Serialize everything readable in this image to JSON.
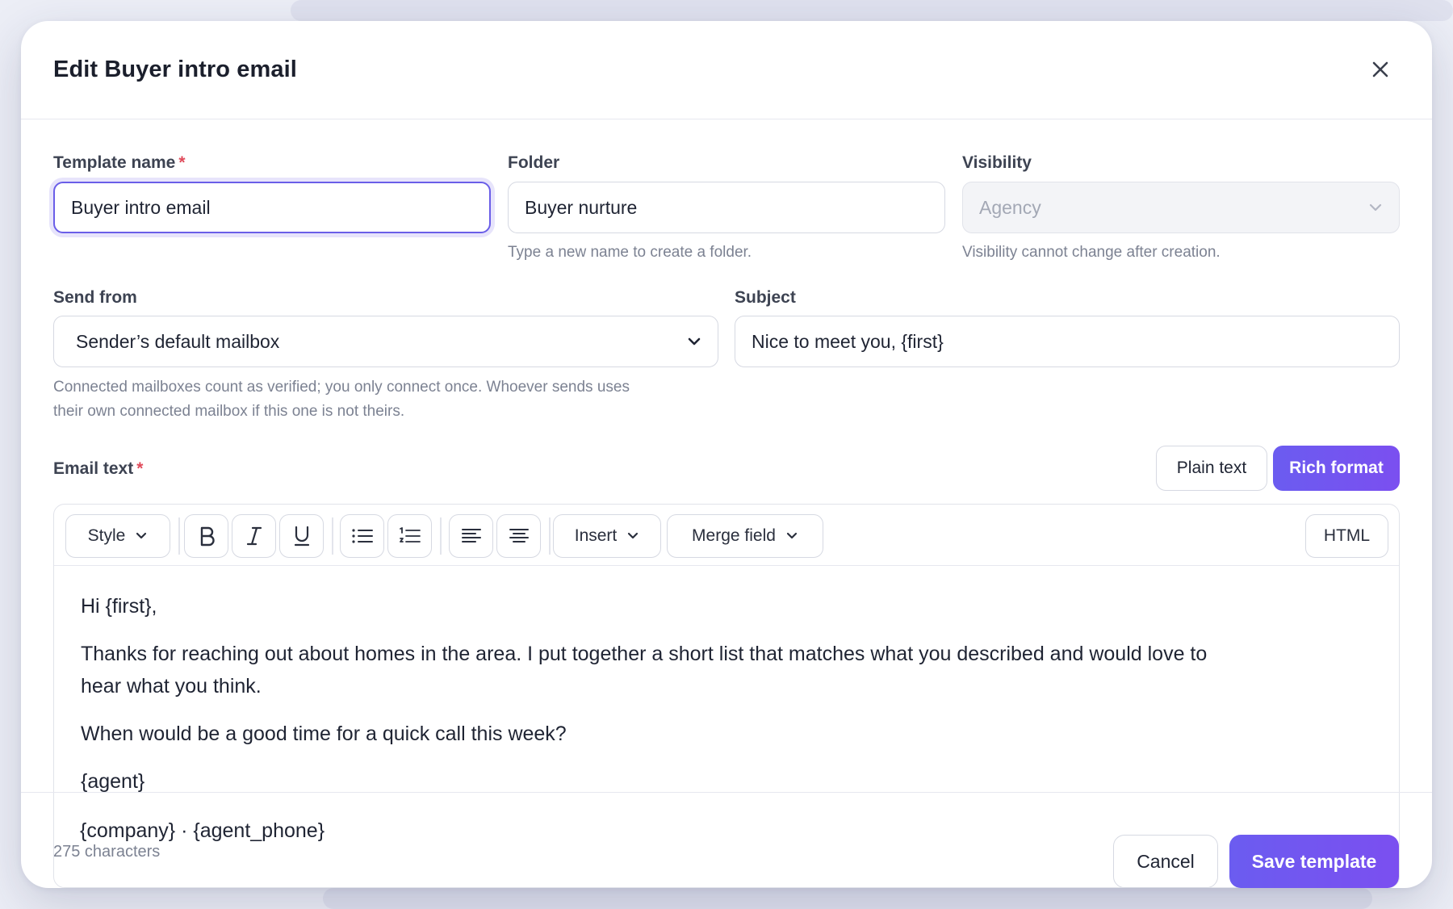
{
  "modal": {
    "title": "Edit Buyer intro email"
  },
  "template_name": {
    "label": "Template name",
    "required_mark": "*",
    "value": "Buyer intro email"
  },
  "folder": {
    "label": "Folder",
    "value": "Buyer nurture",
    "hint": "Type a new name to create a folder."
  },
  "visibility": {
    "label": "Visibility",
    "value": "Agency",
    "hint": "Visibility cannot change after creation."
  },
  "send_from": {
    "label": "Send from",
    "value": "Sender’s default mailbox",
    "hint_line1": "Connected mailboxes count as verified; you only connect once. Whoever sends uses",
    "hint_line2": "their own connected mailbox if this one is not theirs."
  },
  "subject": {
    "label": "Subject",
    "value": "Nice to meet you, {first}"
  },
  "email_text": {
    "label": "Email text",
    "required_mark": "*",
    "format_plain": "Plain text",
    "format_rich": "Rich format",
    "active_format": "Rich format"
  },
  "toolbar": {
    "style": "Style",
    "insert": "Insert",
    "merge_field": "Merge field",
    "html": "HTML"
  },
  "body": {
    "p1": "Hi {first},",
    "p2_line1": "Thanks for reaching out about homes in the area. I put together a short list that matches what you described and would love to",
    "p2_line2": "hear what you think.",
    "p3": "When would be a good time for a quick call this week?",
    "sig1": "{agent}",
    "sig2": "{company} · {agent_phone}"
  },
  "footer": {
    "char_count": "275 characters",
    "cancel": "Cancel",
    "save": "Save template"
  },
  "colors": {
    "accent": "#6b5cf0",
    "required": "#e04a5a"
  }
}
